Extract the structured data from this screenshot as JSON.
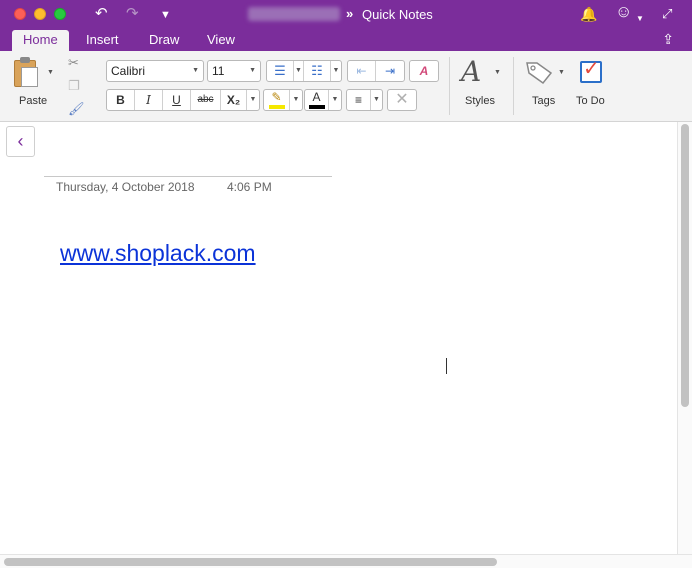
{
  "window": {
    "title": "Quick Notes",
    "breadcrumb_separator": "»"
  },
  "titlebar_icons": {
    "undo": "↶",
    "redo": "↷",
    "qat": "▼",
    "bell": "🔔",
    "smiley": "☺",
    "smiley_caret": "▼",
    "expand": "⤢"
  },
  "tabs": [
    {
      "label": "Home",
      "active": true
    },
    {
      "label": "Insert",
      "active": false
    },
    {
      "label": "Draw",
      "active": false
    },
    {
      "label": "View",
      "active": false
    }
  ],
  "ribbon": {
    "paste_label": "Paste",
    "font_name": "Calibri",
    "font_size": "11",
    "format": {
      "bold": "B",
      "italic": "I",
      "underline": "U",
      "strikethrough": "abc",
      "subscript": "X₂"
    },
    "highlight_color": "#f5e800",
    "font_color": "#000000",
    "styles_label": "Styles",
    "styles_icon": "A",
    "tags_label": "Tags",
    "todo_label": "To Do",
    "todo_check": "✓"
  },
  "note": {
    "date": "Thursday, 4 October 2018",
    "time": "4:06 PM",
    "link_text": "www.shoplack.com"
  },
  "colors": {
    "accent": "#7b2d9b",
    "link": "#0b33d8"
  }
}
